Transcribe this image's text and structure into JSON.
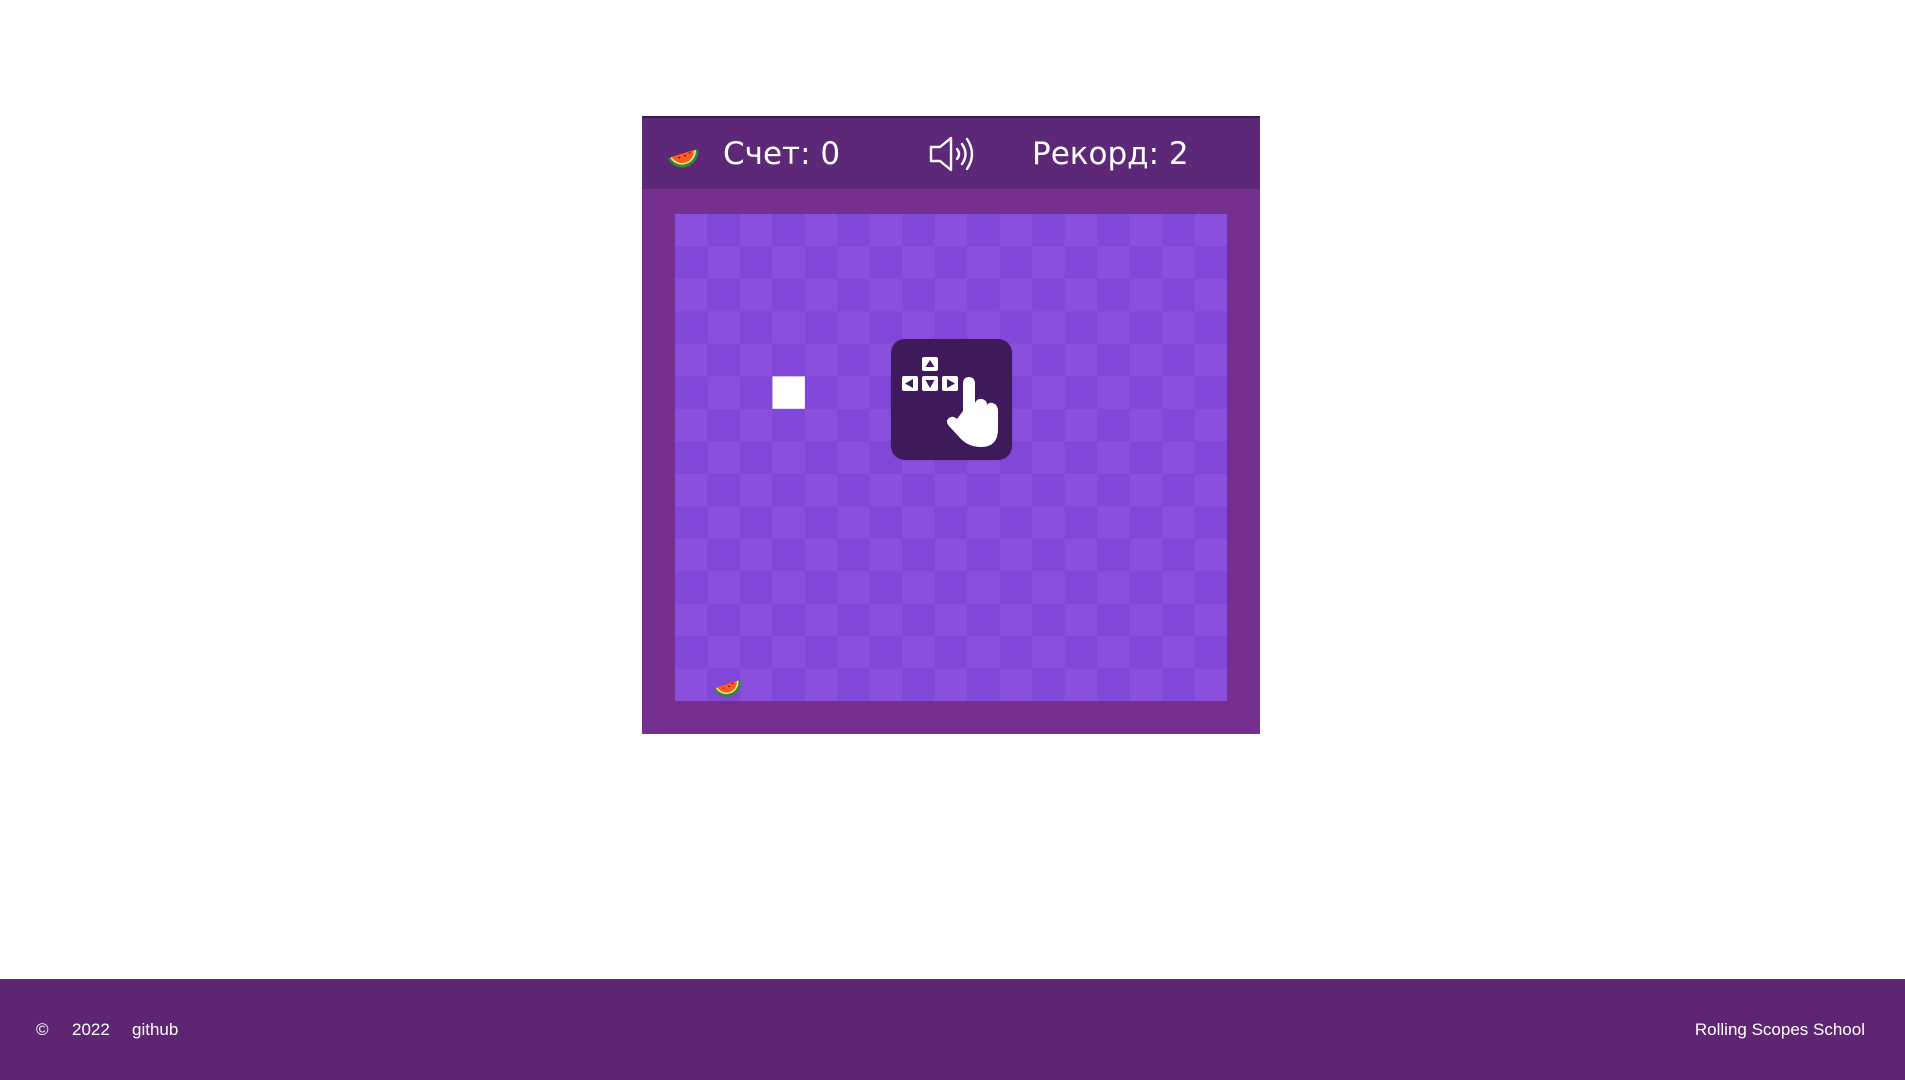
{
  "header": {
    "score_label": "Счет:",
    "score_value": "0",
    "record_label": "Рекорд:",
    "record_value": "2",
    "fruit_icon": "watermelon-icon",
    "sound_icon": "speaker-icon"
  },
  "board": {
    "columns": 17,
    "rows": 15,
    "snake": [
      {
        "col": 3,
        "row": 5
      }
    ],
    "food": {
      "col": 1,
      "row": 14,
      "icon": "watermelon-icon"
    },
    "hint_icon": "arrow-keys-hand-icon",
    "colors": {
      "cell_light": "#8a4fdc",
      "cell_dark": "#8147d8",
      "snake": "#ffffff"
    }
  },
  "footer": {
    "copyright": "©",
    "year": "2022",
    "github": "github",
    "school": "Rolling Scopes School"
  },
  "colors": {
    "frame": "#752f8f",
    "header_bg": "#5e2878",
    "footer_bg": "#5e2672",
    "hint_bg": "#3f1a5a"
  }
}
